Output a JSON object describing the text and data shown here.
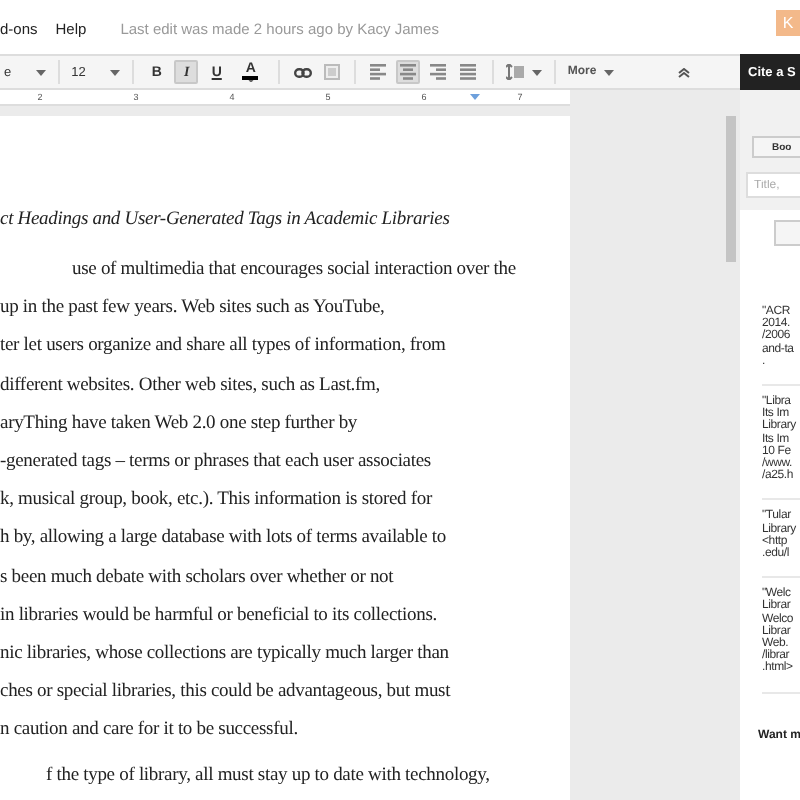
{
  "menu": [
    {
      "label": "d-ons"
    },
    {
      "label": "Help"
    }
  ],
  "last_edit": "Last edit was made 2 hours ago by Kacy James",
  "avatar": "K",
  "toolbar": {
    "font_name": "e",
    "font_size": "12",
    "format_buttons": [
      {
        "kind": "bold",
        "label": "B",
        "selected": false
      },
      {
        "kind": "italic",
        "label": "I",
        "selected": true
      },
      {
        "kind": "underline",
        "label": "U",
        "selected": false
      },
      {
        "kind": "color",
        "label": "A",
        "selected": false
      }
    ],
    "align_buttons": [
      {
        "kind": "left",
        "selected": false
      },
      {
        "kind": "center",
        "selected": true
      },
      {
        "kind": "right",
        "selected": false
      },
      {
        "kind": "justify",
        "selected": false
      }
    ],
    "more": "More"
  },
  "ruler": {
    "ticks": [
      "2",
      "3",
      "4",
      "5",
      "6",
      "7"
    ]
  },
  "document": {
    "title": "ct Headings and User-Generated Tags in Academic Libraries",
    "lines": [
      "use of multimedia that encourages social interaction over the",
      "up in the past few years.  Web sites such as YouTube,",
      "ter let users organize and share all types of information, from",
      "different websites.  Other web sites, such as Last.fm,",
      "aryThing have taken Web 2.0 one step further by",
      "-generated tags – terms or phrases that each user associates",
      "k, musical group, book, etc.).  This information is stored for",
      "h by, allowing a large database with lots of terms available to",
      "s been much debate with scholars over whether or not",
      "in libraries would be harmful or beneficial to its collections.",
      "nic libraries, whose collections are typically much larger than",
      "ches or special libraries, this could be advantageous, but must",
      "n caution and care for it to be successful."
    ],
    "last_line": "f the type of library, all must stay up to date with technology,"
  },
  "sidebar": {
    "title": "Cite a S",
    "source_button": "Boo",
    "search": {
      "placeholder": "Title,"
    },
    "citations": [
      {
        "lines": [
          "\"ACR",
          "2014.",
          "/2006",
          "and-ta",
          "."
        ]
      },
      {
        "lines": [
          "\"Libra",
          "Its Im",
          "Library",
          "Its Im",
          "10 Fe",
          "/www.",
          "/a25.h"
        ]
      },
      {
        "lines": [
          "\"Tular",
          "Library",
          "<http",
          ".edu/l"
        ]
      },
      {
        "lines": [
          "\"Welc",
          "Librar",
          "Welco",
          "Librar",
          "Web.",
          "/librar",
          ".html>"
        ]
      }
    ],
    "footer": "Want m"
  }
}
